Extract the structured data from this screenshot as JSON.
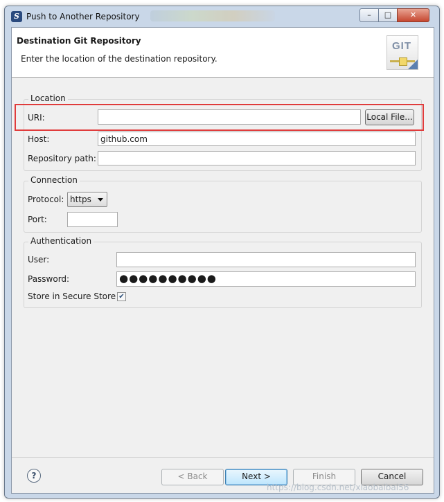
{
  "window": {
    "title": "Push to Another Repository",
    "icon": "eclipse-icon",
    "controls": {
      "minimize": "–",
      "maximize": "□",
      "close": "✕"
    }
  },
  "header": {
    "title": "Destination Git Repository",
    "description": "Enter the location of the destination repository.",
    "icon": "git-repository-icon",
    "icon_text": "GIT"
  },
  "location": {
    "group_label": "Location",
    "uri_label": "URI:",
    "uri_value": "",
    "local_file_button": "Local File...",
    "host_label": "Host:",
    "host_value": "github.com",
    "repo_path_label": "Repository path:",
    "repo_path_value": ""
  },
  "connection": {
    "group_label": "Connection",
    "protocol_label": "Protocol:",
    "protocol_value": "https",
    "port_label": "Port:",
    "port_value": ""
  },
  "authentication": {
    "group_label": "Authentication",
    "user_label": "User:",
    "user_value": "",
    "password_label": "Password:",
    "password_value": "●●●●●●●●●●",
    "secure_store_label": "Store in Secure Store",
    "secure_store_checked": true,
    "checkmark": "✔"
  },
  "footer": {
    "help_symbol": "?",
    "back": "< Back",
    "next": "Next >",
    "finish": "Finish",
    "cancel": "Cancel"
  },
  "watermark": "https://blog.csdn.net/xiaobaibai56",
  "colors": {
    "highlight": "#e03c3c",
    "accent": "#3c7fb1"
  }
}
